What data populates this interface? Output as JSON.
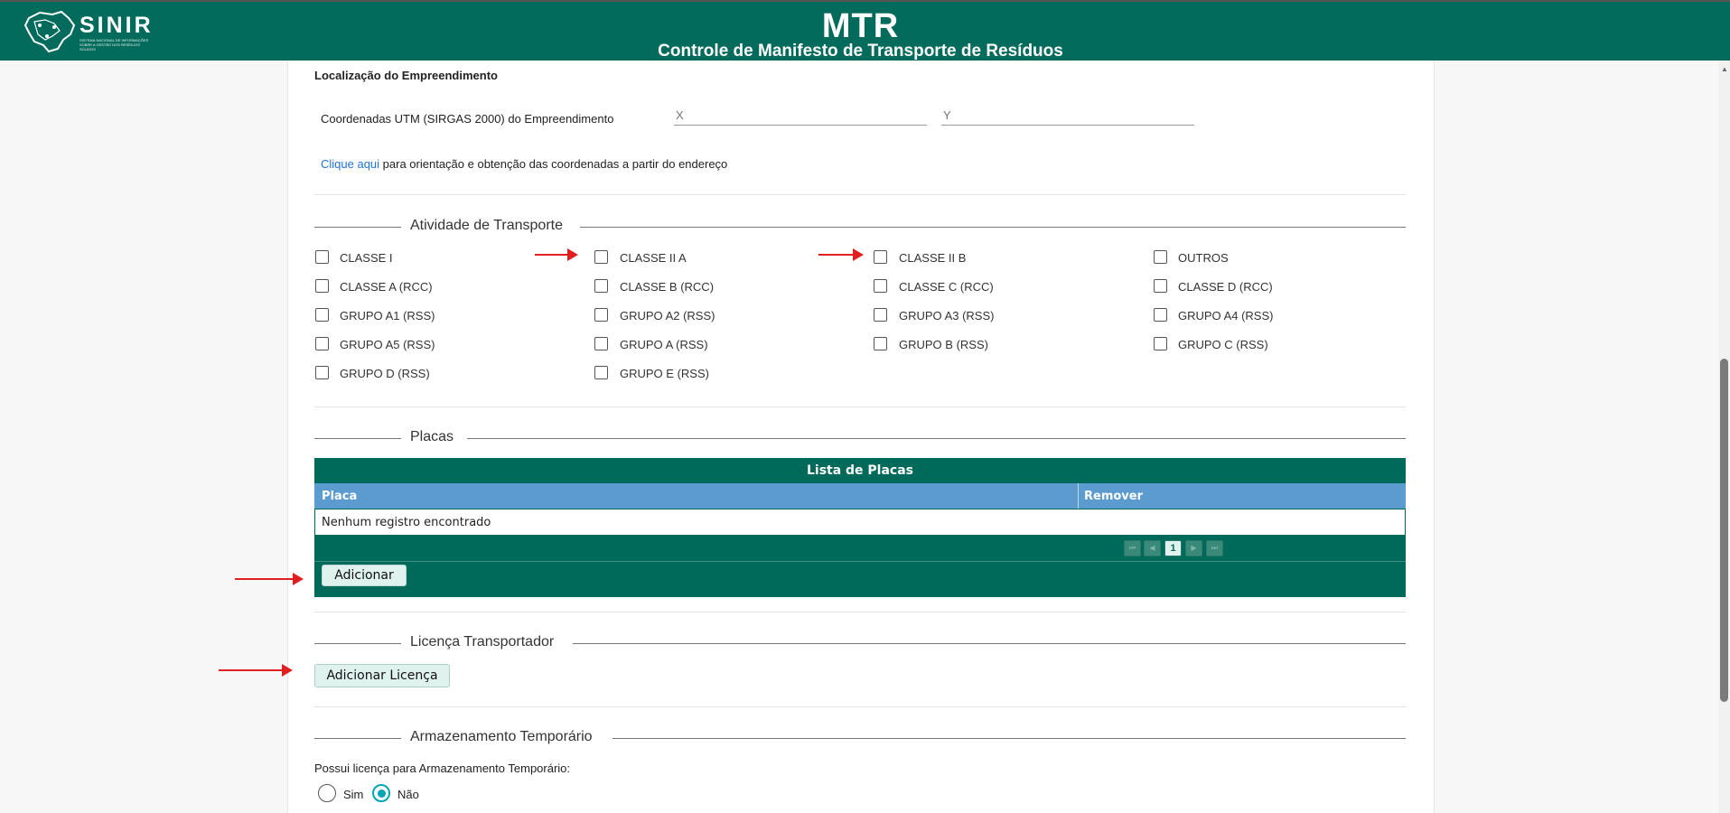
{
  "header": {
    "logo_text": "SINIR",
    "logo_subtitle": "SISTEMA NACIONAL DE INFORMAÇÕES SOBRE A GESTÃO DOS RESÍDUOS SÓLIDOS",
    "title": "MTR",
    "subtitle": "Controle de Manifesto de Transporte de Resíduos"
  },
  "localizacao": {
    "heading": "Localização do Empreendimento",
    "coords_label": "Coordenadas UTM (SIRGAS 2000) do Empreendimento",
    "x_placeholder": "X",
    "y_placeholder": "Y",
    "help_link": "Clique aqui",
    "help_text": "para orientação e obtenção das coordenadas a partir do endereço"
  },
  "atividade": {
    "title": "Atividade de Transporte",
    "options": [
      "CLASSE I",
      "CLASSE II A",
      "CLASSE II B",
      "OUTROS",
      "CLASSE A (RCC)",
      "CLASSE B (RCC)",
      "CLASSE C (RCC)",
      "CLASSE D (RCC)",
      "GRUPO A1 (RSS)",
      "GRUPO A2 (RSS)",
      "GRUPO A3 (RSS)",
      "GRUPO A4 (RSS)",
      "GRUPO A5 (RSS)",
      "GRUPO A (RSS)",
      "GRUPO B (RSS)",
      "GRUPO C (RSS)",
      "GRUPO D (RSS)",
      "GRUPO E (RSS)"
    ]
  },
  "placas": {
    "title": "Placas",
    "table_title": "Lista de Placas",
    "columns": [
      "Placa",
      "Remover"
    ],
    "empty_message": "Nenhum registro encontrado",
    "current_page": "1",
    "add_button": "Adicionar"
  },
  "licenca": {
    "title": "Licença Transportador",
    "add_button": "Adicionar Licença"
  },
  "armazenamento": {
    "title": "Armazenamento Temporário",
    "question": "Possui licença para Armazenamento Temporário:",
    "options": [
      "Sim",
      "Não"
    ],
    "selected": "Não"
  },
  "colors": {
    "brand": "#036b5b",
    "table_header": "#5b9bd0",
    "link": "#1e73d8",
    "annotation_arrow": "#e02020",
    "radio_selected": "#00a6b4"
  }
}
